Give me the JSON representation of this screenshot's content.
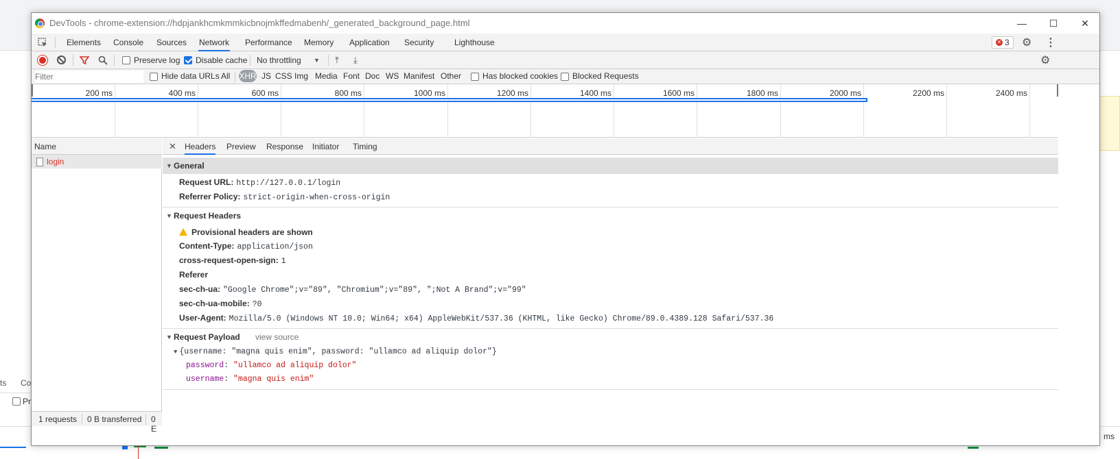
{
  "window": {
    "title": "DevTools - chrome-extension://hdpjankhcmkmmkicbnojmkffedmabenh/_generated_background_page.html"
  },
  "tabs": [
    "Elements",
    "Console",
    "Sources",
    "Network",
    "Performance",
    "Memory",
    "Application",
    "Security",
    "Lighthouse"
  ],
  "active_tab": "Network",
  "error_count": "3",
  "toolbar": {
    "preserve_log": "Preserve log",
    "disable_cache": "Disable cache",
    "throttling": "No throttling"
  },
  "filterbar": {
    "filter_placeholder": "Filter",
    "hide_data_urls": "Hide data URLs",
    "types": [
      "All",
      "XHR",
      "JS",
      "CSS",
      "Img",
      "Media",
      "Font",
      "Doc",
      "WS",
      "Manifest",
      "Other"
    ],
    "selected_type": "XHR",
    "has_blocked_cookies": "Has blocked cookies",
    "blocked_requests": "Blocked Requests"
  },
  "overview": {
    "ticks": [
      "200 ms",
      "400 ms",
      "600 ms",
      "800 ms",
      "1000 ms",
      "1200 ms",
      "1400 ms",
      "1600 ms",
      "1800 ms",
      "2000 ms",
      "2200 ms",
      "2400 ms"
    ]
  },
  "requests": {
    "column": "Name",
    "items": [
      "login"
    ]
  },
  "status": {
    "requests": "1 requests",
    "transferred": "0 B transferred",
    "resources": "0 E"
  },
  "detail_tabs": [
    "Headers",
    "Preview",
    "Response",
    "Initiator",
    "Timing"
  ],
  "general": {
    "title": "General",
    "request_url_key": "Request URL:",
    "request_url": "http://127.0.0.1/login",
    "referrer_policy_key": "Referrer Policy:",
    "referrer_policy": "strict-origin-when-cross-origin"
  },
  "request_headers": {
    "title": "Request Headers",
    "warning": "Provisional headers are shown",
    "rows": [
      {
        "key": "Content-Type:",
        "value": "application/json"
      },
      {
        "key": "cross-request-open-sign:",
        "value": "1"
      },
      {
        "key": "Referer",
        "value": ""
      },
      {
        "key": "sec-ch-ua:",
        "value": "\"Google Chrome\";v=\"89\", \"Chromium\";v=\"89\", \";Not A Brand\";v=\"99\""
      },
      {
        "key": "sec-ch-ua-mobile:",
        "value": "?0"
      },
      {
        "key": "User-Agent:",
        "value": "Mozilla/5.0 (Windows NT 10.0; Win64; x64) AppleWebKit/537.36 (KHTML, like Gecko) Chrome/89.0.4389.128 Safari/537.36"
      }
    ]
  },
  "payload": {
    "title": "Request Payload",
    "view_source": "view source",
    "summary": "{username: \"magna quis enim\", password: \"ullamco ad aliquip dolor\"}",
    "password_key": "password",
    "password_value": "\"ullamco ad aliquip dolor\"",
    "username_key": "username",
    "username_value": "\"magna quis enim\""
  },
  "background": {
    "tab_a": "ts",
    "tab_b": "Co",
    "checkbox_label": "Pr",
    "right_ms": "ms"
  }
}
